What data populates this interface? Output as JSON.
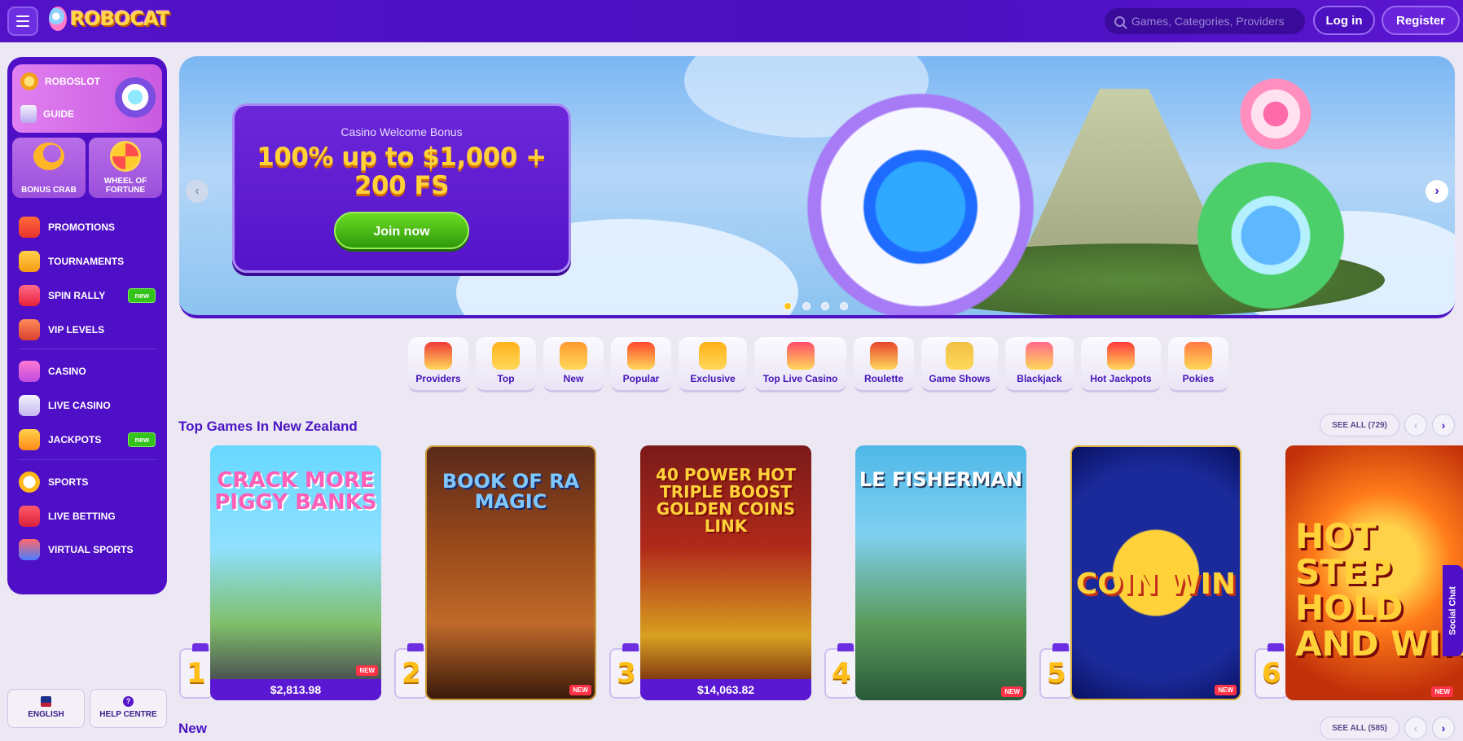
{
  "header": {
    "logo_text": "ROBOCAT",
    "search_placeholder": "Games, Categories, Providers",
    "login_label": "Log in",
    "register_label": "Register"
  },
  "sidebar": {
    "top_items": [
      {
        "label": "ROBOSLOT",
        "icon": "coin-icon"
      },
      {
        "label": "GUIDE",
        "icon": "guide-icon"
      }
    ],
    "tiles": [
      {
        "label": "BONUS CRAB",
        "icon": "crab-icon"
      },
      {
        "label": "WHEEL OF FORTUNE",
        "icon": "wheel-icon"
      }
    ],
    "group1": [
      {
        "label": "PROMOTIONS",
        "icon": "gift-icon"
      },
      {
        "label": "TOURNAMENTS",
        "icon": "trophy-icon"
      },
      {
        "label": "SPIN RALLY",
        "icon": "car-icon",
        "badge": "new"
      },
      {
        "label": "VIP LEVELS",
        "icon": "vip-icon"
      }
    ],
    "group2": [
      {
        "label": "CASINO",
        "icon": "casino-icon"
      },
      {
        "label": "LIVE CASINO",
        "icon": "cards-icon"
      },
      {
        "label": "JACKPOTS",
        "icon": "jackpot-icon",
        "badge": "new"
      }
    ],
    "group3": [
      {
        "label": "SPORTS",
        "icon": "ball-icon"
      },
      {
        "label": "LIVE BETTING",
        "icon": "live-icon"
      },
      {
        "label": "VIRTUAL SPORTS",
        "icon": "virtual-icon"
      }
    ],
    "language_label": "ENGLISH",
    "help_label": "HELP CENTRE",
    "help_glyph": "?"
  },
  "banner": {
    "subtitle": "Casino Welcome Bonus",
    "title": "100% up to $1,000 + 200 FS",
    "cta": "Join now",
    "prev_glyph": "‹",
    "next_glyph": "›"
  },
  "categories": [
    {
      "label": "Providers",
      "color": "#ef3a3a"
    },
    {
      "label": "Top",
      "color": "#ffb21e"
    },
    {
      "label": "New",
      "color": "#ff9a2e"
    },
    {
      "label": "Popular",
      "color": "#ff4a2e"
    },
    {
      "label": "Exclusive",
      "color": "#ffb018"
    },
    {
      "label": "Top Live Casino",
      "color": "#ff4d6a"
    },
    {
      "label": "Roulette",
      "color": "#e8452e"
    },
    {
      "label": "Game Shows",
      "color": "#f0c046"
    },
    {
      "label": "Blackjack",
      "color": "#ff6a8a"
    },
    {
      "label": "Hot Jackpots",
      "color": "#ff3b3b"
    },
    {
      "label": "Pokies",
      "color": "#ff7a40"
    }
  ],
  "top_games": {
    "title": "Top Games In New Zealand",
    "see_all": "SEE ALL (729)",
    "games": [
      {
        "rank": "1",
        "name": "CRACK MORE PIGGY BANKS",
        "jackpot": "$2,813.98",
        "new": "NEW"
      },
      {
        "rank": "2",
        "name": "BOOK OF RA MAGIC",
        "jackpot": "",
        "new": "NEW"
      },
      {
        "rank": "3",
        "name": "40 POWER HOT TRIPLE BOOST GOLDEN COINS LINK",
        "jackpot": "$14,063.82",
        "new": ""
      },
      {
        "rank": "4",
        "name": "LE FISHERMAN",
        "jackpot": "",
        "new": "NEW"
      },
      {
        "rank": "5",
        "name": "COIN WIN",
        "jackpot": "",
        "new": "NEW"
      },
      {
        "rank": "6",
        "name": "HOT STEP HOLD AND WIN",
        "jackpot": "",
        "new": "NEW"
      }
    ]
  },
  "new_section": {
    "title": "New",
    "see_all": "SEE ALL (585)"
  },
  "social_chat": "Social Chat"
}
